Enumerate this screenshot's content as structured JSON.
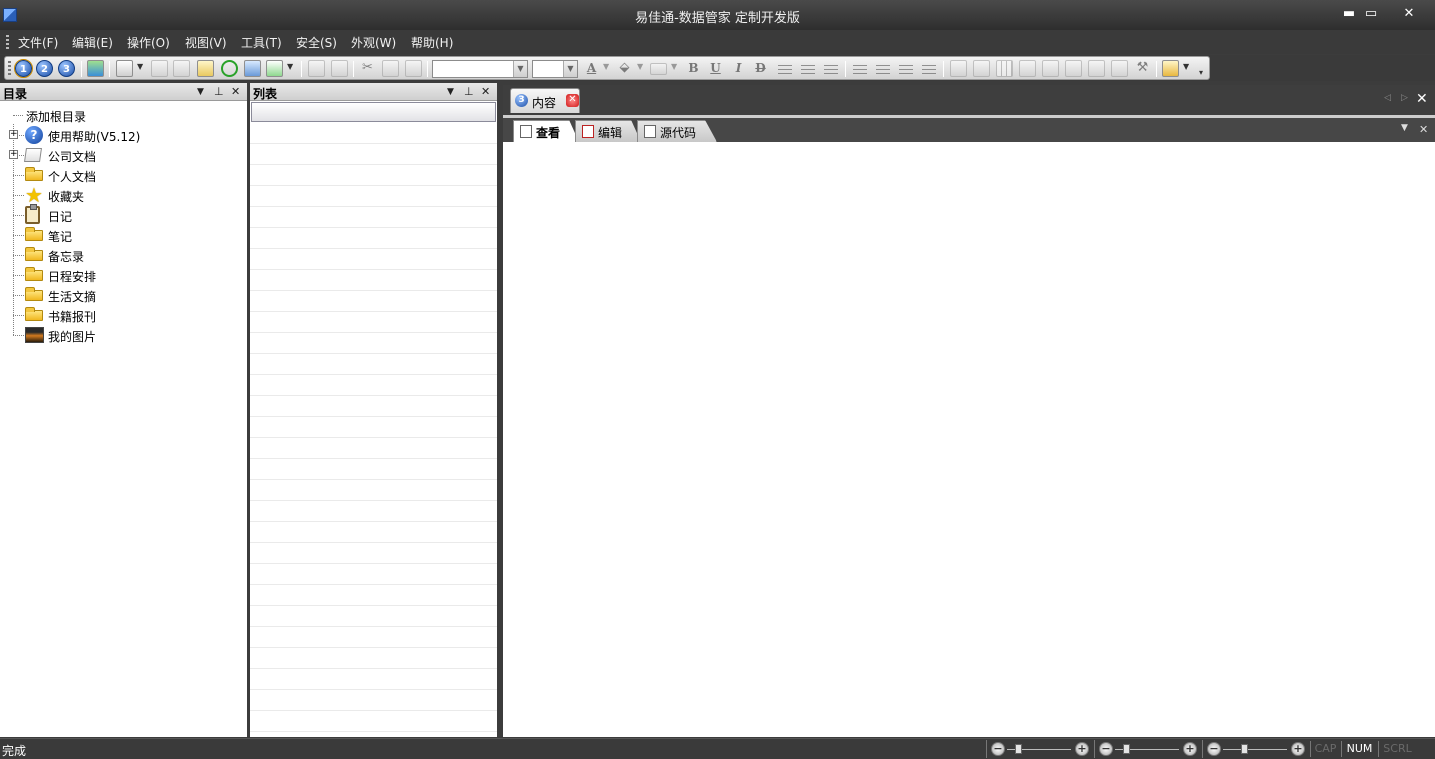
{
  "window": {
    "title": "易佳通-数据管家 定制开发版",
    "minimize": "▬",
    "restore": "▭",
    "close": "✕"
  },
  "menu": [
    {
      "label": "文件(F)"
    },
    {
      "label": "编辑(E)"
    },
    {
      "label": "操作(O)"
    },
    {
      "label": "视图(V)"
    },
    {
      "label": "工具(T)"
    },
    {
      "label": "安全(S)"
    },
    {
      "label": "外观(W)"
    },
    {
      "label": "帮助(H)"
    }
  ],
  "toolbar": {
    "level_buttons": [
      "1",
      "2",
      "3"
    ],
    "active_level": "1",
    "format_buttons": [
      "B",
      "U",
      "I",
      "D"
    ],
    "font_combo_value": "",
    "size_combo_value": ""
  },
  "panels": {
    "tree": {
      "title": "目录"
    },
    "list": {
      "title": "列表"
    }
  },
  "tree_items": [
    {
      "label": "添加根目录",
      "icon": "none",
      "root": true
    },
    {
      "label": "使用帮助(V5.12)",
      "icon": "help-icon",
      "expandable": true
    },
    {
      "label": "公司文档",
      "icon": "document-icon",
      "expandable": true
    },
    {
      "label": "个人文档",
      "icon": "folder-icon"
    },
    {
      "label": "收藏夹",
      "icon": "star-icon"
    },
    {
      "label": "日记",
      "icon": "clipboard-icon"
    },
    {
      "label": "笔记",
      "icon": "folder-icon"
    },
    {
      "label": "备忘录",
      "icon": "folder-icon"
    },
    {
      "label": "日程安排",
      "icon": "folder-icon"
    },
    {
      "label": "生活文摘",
      "icon": "folder-icon"
    },
    {
      "label": "书籍报刊",
      "icon": "folder-icon"
    },
    {
      "label": "我的图片",
      "icon": "picture-icon"
    }
  ],
  "content": {
    "tab_badge": "3",
    "tab_label": "内容",
    "subtabs": [
      {
        "label": "查看",
        "active": true
      },
      {
        "label": "编辑",
        "active": false
      },
      {
        "label": "源代码",
        "active": false
      }
    ]
  },
  "status": {
    "text": "完成",
    "indicators": [
      {
        "label": "CAP",
        "on": false
      },
      {
        "label": "NUM",
        "on": true
      },
      {
        "label": "SCRL",
        "on": false
      }
    ]
  },
  "colors": {
    "chrome": "#3a3a3a",
    "pane": "#ffffff",
    "accent": "#1c4fa8"
  }
}
